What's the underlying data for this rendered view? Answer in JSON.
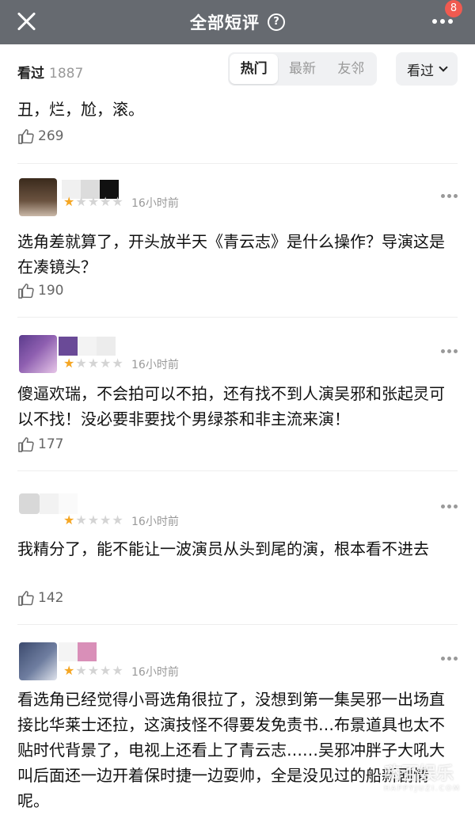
{
  "nav": {
    "title": "全部短评",
    "help_icon": "?",
    "badge": "8"
  },
  "filter": {
    "seen_label": "看过",
    "seen_count": "1887",
    "tabs": [
      "热门",
      "最新",
      "友邻"
    ],
    "active_tab": "热门",
    "dropdown_label": "看过"
  },
  "comments": [
    {
      "text": "丑，烂，尬，滚。",
      "likes": "269"
    },
    {
      "rating": 1,
      "time": "16小时前",
      "text": "选角差就算了，开头放半天《青云志》是什么操作？导演这是在凑镜头？",
      "likes": "190"
    },
    {
      "rating": 1,
      "time": "16小时前",
      "text": "傻逼欢瑞，不会拍可以不拍，还有找不到人演吴邪和张起灵可以不找！没必要非要找个男绿茶和非主流来演！",
      "likes": "177"
    },
    {
      "rating": 1,
      "time": "16小时前",
      "text": "我精分了，能不能让一波演员从头到尾的演，根本看不进去",
      "likes": "142"
    },
    {
      "rating": 1,
      "time": "16小时前",
      "text": "看选角已经觉得小哥选角很拉了，没想到第一集吴邪一出场直接比华莱士还拉，这演技怪不得要发免责书…布景道具也太不贴时代背景了，电视上还看上了青云志……吴邪冲胖子大吼大叫后面还一边开着保时捷一边耍帅，全是没见过的船新剧情呢。"
    }
  ],
  "watermark": {
    "main": "嗨否娱乐",
    "sub": "HAPPYJUZI.COM"
  },
  "colors": {
    "navbar": "#666a70",
    "badge": "#f05a50",
    "star_on": "#f5a623"
  }
}
